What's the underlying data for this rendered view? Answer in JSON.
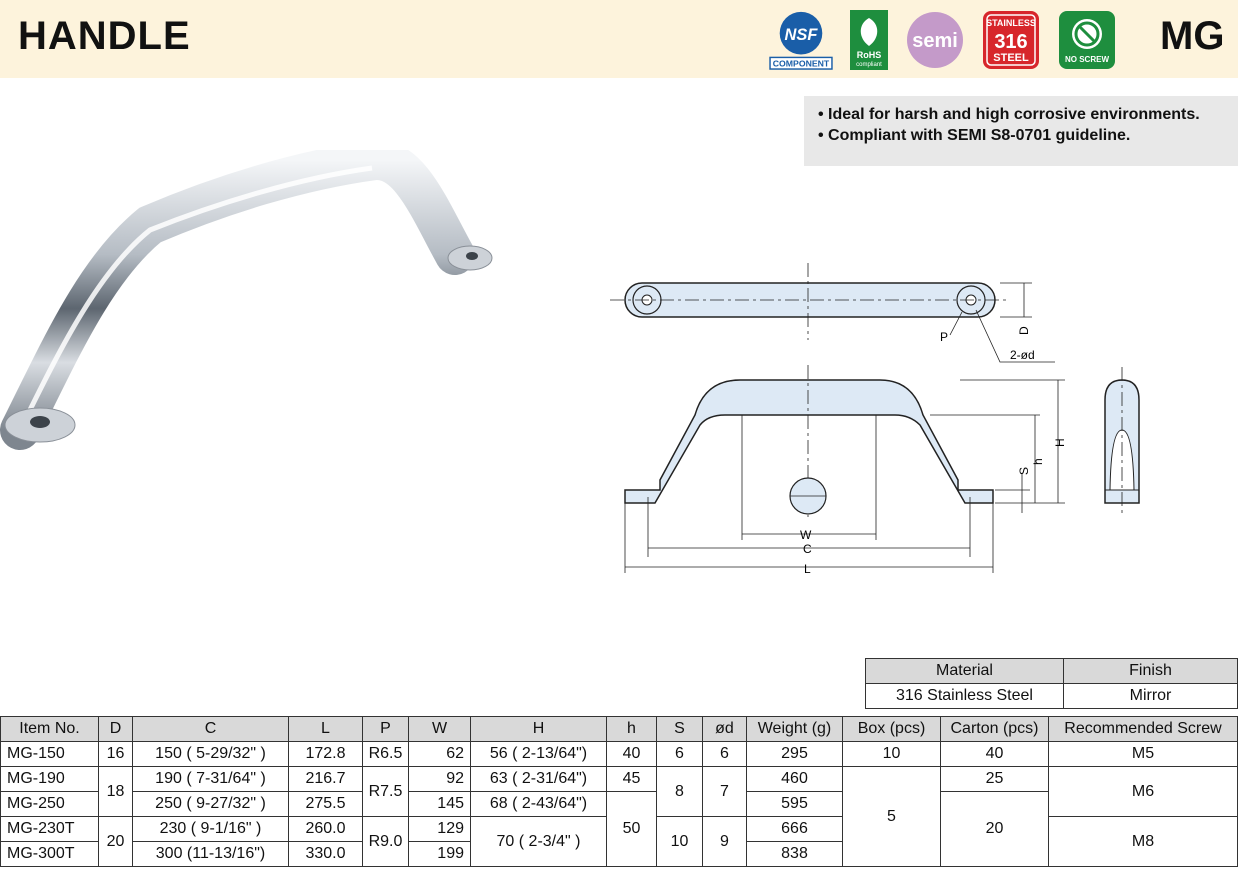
{
  "header": {
    "title": "HANDLE",
    "code": "MG"
  },
  "badges": [
    {
      "icon": "nsf-icon",
      "text": "NSF",
      "sub": "COMPONENT"
    },
    {
      "icon": "rohs-icon",
      "text": "RoHS",
      "sub": "compliant"
    },
    {
      "icon": "semi-icon",
      "text": "semi"
    },
    {
      "icon": "stainless-316-icon",
      "top": "STAINLESS",
      "num": "316",
      "bottom": "STEEL"
    },
    {
      "icon": "no-screw-icon",
      "text": "NO SCREW"
    }
  ],
  "features": [
    "• Ideal for harsh and high corrosive environments.",
    "• Compliant with SEMI S8-0701 guideline."
  ],
  "drawing": {
    "labels": {
      "D": "D",
      "P": "P",
      "d": "2-ød",
      "H": "H",
      "h": "h",
      "S": "S",
      "W": "W",
      "C": "C",
      "L": "L"
    }
  },
  "material_table": {
    "headers": [
      "Material",
      "Finish"
    ],
    "row": [
      "316 Stainless Steel",
      "Mirror"
    ]
  },
  "spec_table": {
    "headers": [
      "Item No.",
      "D",
      "C",
      "L",
      "P",
      "W",
      "H",
      "h",
      "S",
      "ød",
      "Weight (g)",
      "Box (pcs)",
      "Carton (pcs)",
      "Recommended Screw"
    ],
    "item": [
      "MG-150",
      "MG-190",
      "MG-250",
      "MG-230T",
      "MG-300T"
    ],
    "D": [
      "16",
      "18",
      "20"
    ],
    "C": [
      "150 ( 5-29/32\" )",
      "190 ( 7-31/64\" )",
      "250 ( 9-27/32\" )",
      "230 (  9-1/16\"  )",
      "300 (11-13/16\")"
    ],
    "L": [
      "172.8",
      "216.7",
      "275.5",
      "260.0",
      "330.0"
    ],
    "P": [
      "R6.5",
      "R7.5",
      "R9.0"
    ],
    "W": [
      "62",
      "92",
      "145",
      "129",
      "199"
    ],
    "H": [
      "56 ( 2-13/64\")",
      "63 ( 2-31/64\")",
      "68 ( 2-43/64\")",
      "70 (   2-3/4\"   )"
    ],
    "h": [
      "40",
      "45",
      "50"
    ],
    "S": [
      "6",
      "8",
      "10"
    ],
    "od": [
      "6",
      "7",
      "9"
    ],
    "weight": [
      "295",
      "460",
      "595",
      "666",
      "838"
    ],
    "box": [
      "10",
      "5"
    ],
    "carton": [
      "40",
      "25",
      "20"
    ],
    "screw": [
      "M5",
      "M6",
      "M8"
    ]
  }
}
